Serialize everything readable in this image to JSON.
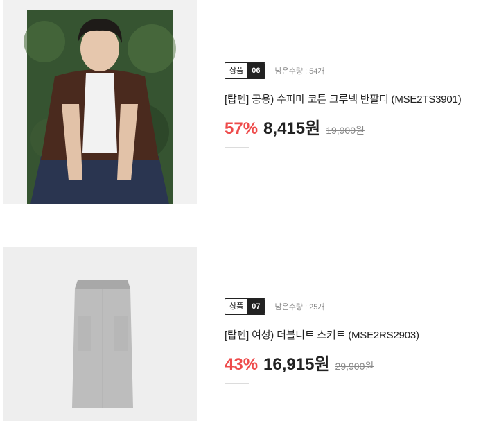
{
  "products": [
    {
      "badge_label": "상품",
      "badge_num": "06",
      "remaining": "남은수량 : 54개",
      "title": "[탑텐] 공용) 수피마 코튼 크루넥 반팔티 (MSE2TS3901)",
      "discount": "57%",
      "price": "8,415원",
      "original_price": "19,900원",
      "image_icon": "model-photo"
    },
    {
      "badge_label": "상품",
      "badge_num": "07",
      "remaining": "남은수량 : 25개",
      "title": "[탑텐] 여성) 더블니트 스커트 (MSE2RS2903)",
      "discount": "43%",
      "price": "16,915원",
      "original_price": "29,900원",
      "image_icon": "skirt-photo"
    }
  ],
  "colors": {
    "discount": "#ee4b4b",
    "badge_dark": "#222222",
    "muted": "#888888"
  }
}
